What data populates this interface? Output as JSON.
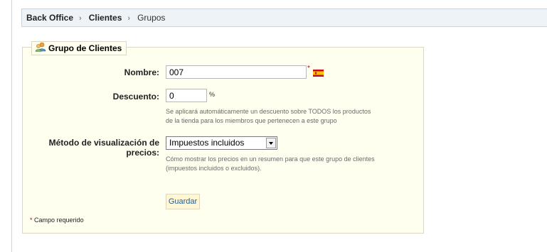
{
  "breadcrumb": {
    "items": [
      "Back Office",
      "Clientes",
      "Grupos"
    ],
    "separator": "›"
  },
  "panel": {
    "legend": "Grupo de Clientes",
    "legend_icon": "users-group-icon"
  },
  "form": {
    "name": {
      "label": "Nombre:",
      "value": "007",
      "required_mark": "*",
      "language_flag": "spain-flag-icon"
    },
    "discount": {
      "label": "Descuento:",
      "value": "0",
      "unit": "%",
      "hint_line1": "Se aplicará automáticamente un descuento sobre TODOS los productos",
      "hint_line2": "de la tienda para los miembros que pertenecen a este grupo"
    },
    "price_display": {
      "label_line1": "Método de visualización de",
      "label_line2": "precios:",
      "selected": "Impuestos incluidos",
      "hint_line1": "Cómo mostrar los precios en un resumen para que este grupo de clientes",
      "hint_line2": "(impuestos incluidos o excluidos)."
    },
    "save_label": "Guardar",
    "required_note_star": "*",
    "required_note_text": "Campo requerido"
  },
  "colors": {
    "breadcrumb_bg": "#eef3f7",
    "panel_bg": "#fffff0",
    "panel_border": "#dfd5c3",
    "required": "#cc0000",
    "button_text": "#2a5b8a"
  }
}
